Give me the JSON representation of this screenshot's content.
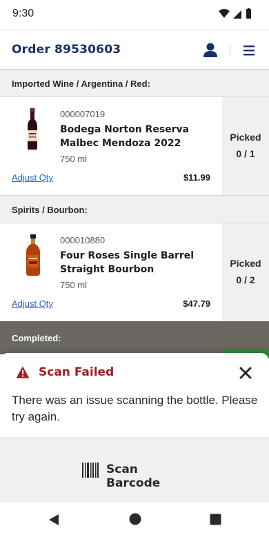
{
  "status_bar": {
    "time": "9:30",
    "icons": [
      "wifi-icon",
      "signal-icon",
      "battery-icon"
    ]
  },
  "header": {
    "title": "Order 89530603",
    "icons": [
      "user-icon",
      "menu-icon"
    ],
    "accent_color": "#15306b"
  },
  "sections": [
    {
      "title": "Imported Wine / Argentina / Red:",
      "item": {
        "sku": "000007019",
        "name": "Bodega Norton Reserva Malbec Mendoza 2022",
        "size": "750 ml",
        "price": "$11.99",
        "adjust_label": "Adjust Qty",
        "picked_label": "Picked",
        "picked_count": "0 / 1",
        "image_icon": "wine-bottle-image"
      }
    },
    {
      "title": "Spirits / Bourbon:",
      "item": {
        "sku": "000010880",
        "name": "Four Roses Single Barrel Straight Bourbon",
        "size": "750 ml",
        "price": "$47.79",
        "adjust_label": "Adjust Qty",
        "picked_label": "Picked",
        "picked_count": "0 / 2",
        "image_icon": "bourbon-bottle-image"
      }
    }
  ],
  "completed": {
    "title": "Completed:",
    "accent_color": "#2e8b3d"
  },
  "toast": {
    "title": "Scan Failed",
    "message": "There was an issue scanning the bottle. Please try again.",
    "icon": "warning-icon",
    "close_icon": "close-icon",
    "color": "#a31e1e"
  },
  "scan": {
    "label": "Scan Barcode",
    "icon": "barcode-icon"
  },
  "nav": {
    "icons": [
      "back-icon",
      "home-icon",
      "recents-icon"
    ]
  }
}
